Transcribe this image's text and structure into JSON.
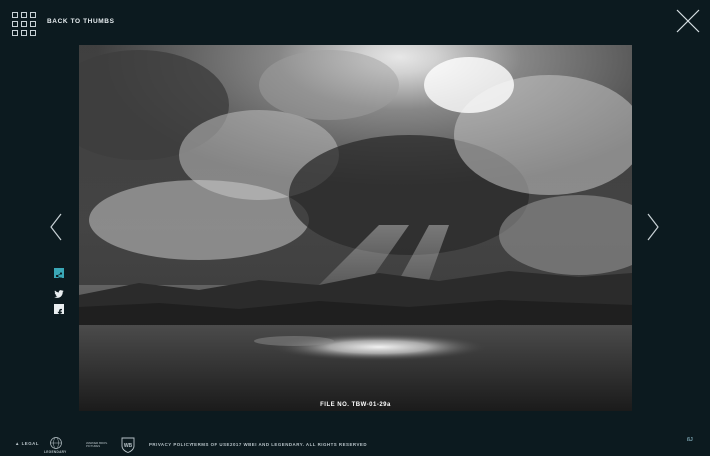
{
  "header": {
    "back_label": "BACK TO THUMBS"
  },
  "photo": {
    "caption": "FILE NO. TBW-01-29a"
  },
  "share": {
    "icons": [
      "share-icon",
      "twitter-icon",
      "facebook-icon"
    ],
    "accent_color": "#3aa7b6"
  },
  "footer": {
    "legal_label": "LEGAL",
    "legendary_label": "LEGENDARY",
    "wb_label": "WARNER BROS. PICTURES",
    "privacy_label": "PRIVACY POLICY",
    "terms_label": "TERMS OF USE",
    "copyright": "2017 WBEI AND LEGENDARY. ALL RIGHTS RESERVED",
    "corner_mark": "ßJ"
  },
  "theme": {
    "background": "#0c1a1f",
    "text": "#e9eef0"
  }
}
